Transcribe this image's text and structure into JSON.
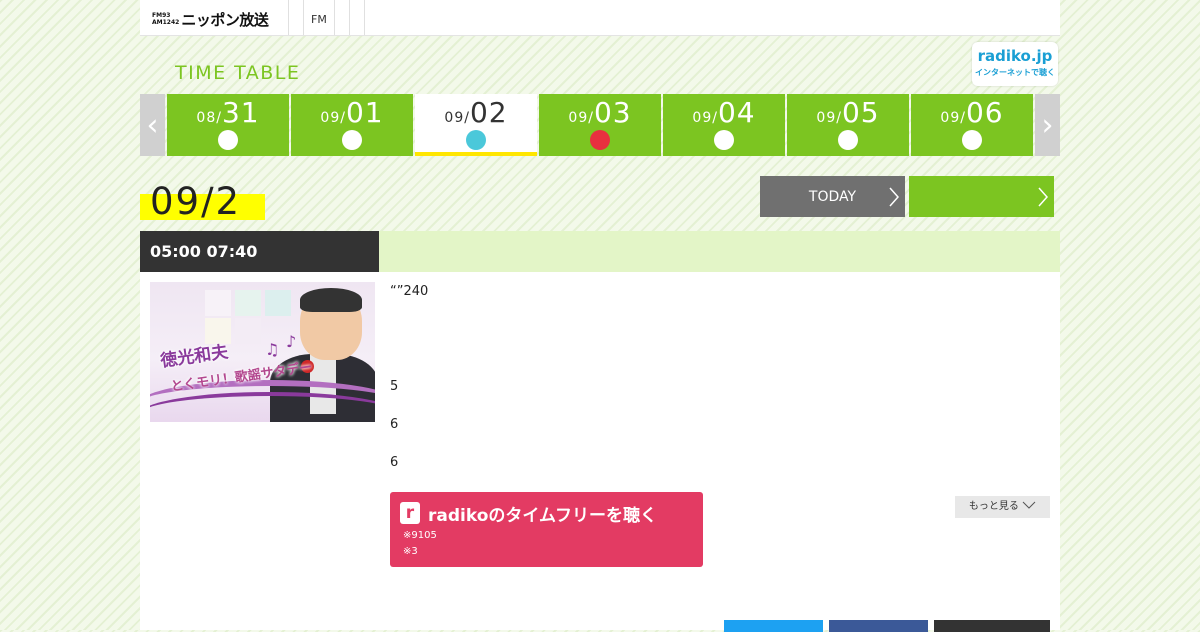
{
  "header": {
    "logo_badge_top": "FM93",
    "logo_badge_bottom": "AM1242",
    "logo_name": "ニッポン放送",
    "nav": [
      "FM"
    ]
  },
  "radiko_badge": {
    "title": "radiko.jp",
    "subtitle": "インターネットで聴く"
  },
  "timetable_title": "TIME TABLE",
  "dates": [
    {
      "month": "08/",
      "day": "31",
      "status": "white"
    },
    {
      "month": "09/",
      "day": "01",
      "status": "white"
    },
    {
      "month": "09/",
      "day": "02",
      "status": "cyan",
      "active": true
    },
    {
      "month": "09/",
      "day": "03",
      "status": "red"
    },
    {
      "month": "09/",
      "day": "04",
      "status": "white"
    },
    {
      "month": "09/",
      "day": "05",
      "status": "white"
    },
    {
      "month": "09/",
      "day": "06",
      "status": "white"
    }
  ],
  "arrows": {
    "prev": "‹",
    "next": "›"
  },
  "selected_date": "09/2",
  "today_button": "TODAY",
  "program": {
    "time": "05:00  07:40",
    "thumb_text_1": "徳光和夫",
    "thumb_text_2": "とくモリ！歌謡サタデー",
    "description": [
      "“”240",
      "5",
      "6",
      "6"
    ],
    "radiko_button": {
      "logo": "r",
      "title": "radikoのタイムフリーを聴く",
      "note1": "※9105",
      "note2": "※3"
    },
    "more_button": "もっと見る"
  },
  "colors": {
    "green": "#7cc521",
    "active_dot": "#4bc8da",
    "red_dot": "#e8303f",
    "highlight": "#ffff00",
    "radiko_pink": "#e33b63",
    "radiko_blue": "#1a9fd4"
  }
}
